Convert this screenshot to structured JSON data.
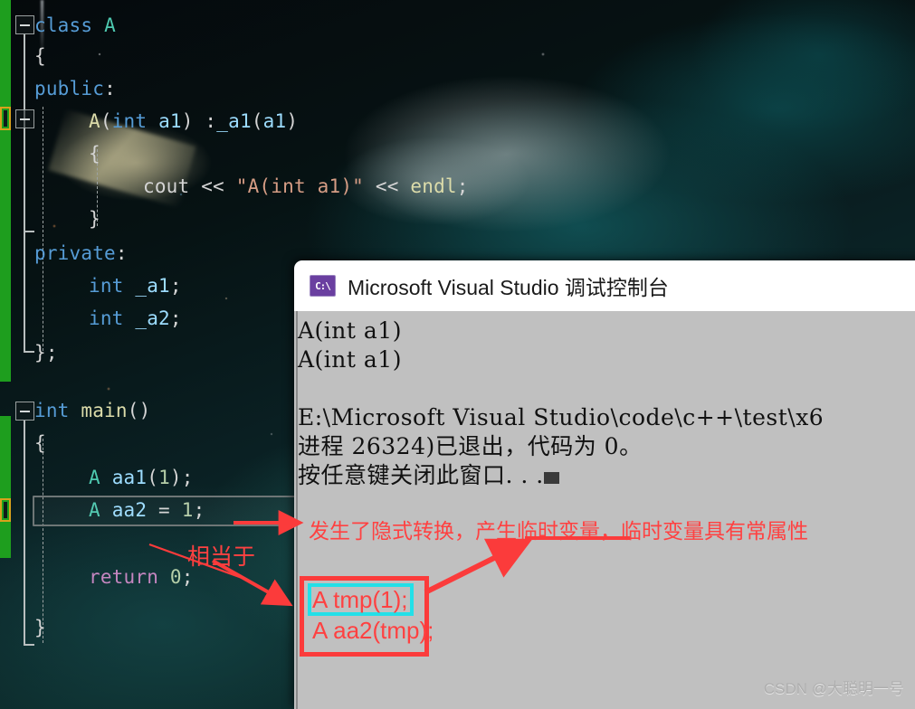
{
  "editor": {
    "language": "cpp",
    "lines": [
      {
        "indent": 0,
        "tokens": [
          {
            "t": "class ",
            "c": "kw"
          },
          {
            "t": "A",
            "c": "ty"
          }
        ]
      },
      {
        "indent": 1,
        "tokens": [
          {
            "t": "{",
            "c": "op"
          }
        ]
      },
      {
        "indent": 1,
        "tokens": [
          {
            "t": "public",
            "c": "kw"
          },
          {
            "t": ":",
            "c": "op"
          }
        ]
      },
      {
        "indent": 2,
        "tokens": [
          {
            "t": "A",
            "c": "pl"
          },
          {
            "t": "(",
            "c": "op"
          },
          {
            "t": "int",
            "c": "kw"
          },
          {
            "t": " ",
            "c": "op"
          },
          {
            "t": "a1",
            "c": "id"
          },
          {
            "t": ") :",
            "c": "op"
          },
          {
            "t": "_a1",
            "c": "id"
          },
          {
            "t": "(",
            "c": "op"
          },
          {
            "t": "a1",
            "c": "id"
          },
          {
            "t": ")",
            "c": "op"
          }
        ]
      },
      {
        "indent": 3,
        "tokens": [
          {
            "t": "{",
            "c": "op"
          }
        ]
      },
      {
        "indent": 4,
        "tokens": [
          {
            "t": "cout",
            "c": "op"
          },
          {
            "t": " << ",
            "c": "op"
          },
          {
            "t": "\"A(int a1)\"",
            "c": "st"
          },
          {
            "t": " << ",
            "c": "op"
          },
          {
            "t": "endl",
            "c": "pl"
          },
          {
            "t": ";",
            "c": "op"
          }
        ]
      },
      {
        "indent": 3,
        "tokens": [
          {
            "t": "}",
            "c": "op"
          }
        ]
      },
      {
        "indent": 1,
        "tokens": [
          {
            "t": "private",
            "c": "kw"
          },
          {
            "t": ":",
            "c": "op"
          }
        ]
      },
      {
        "indent": 2,
        "tokens": [
          {
            "t": "int",
            "c": "kw"
          },
          {
            "t": " ",
            "c": "op"
          },
          {
            "t": "_a1",
            "c": "id"
          },
          {
            "t": ";",
            "c": "op"
          }
        ]
      },
      {
        "indent": 2,
        "tokens": [
          {
            "t": "int",
            "c": "kw"
          },
          {
            "t": " ",
            "c": "op"
          },
          {
            "t": "_a2",
            "c": "id"
          },
          {
            "t": ";",
            "c": "op"
          }
        ]
      },
      {
        "indent": 1,
        "tokens": [
          {
            "t": "};",
            "c": "op"
          }
        ]
      },
      {
        "indent": 0,
        "tokens": []
      },
      {
        "indent": 0,
        "tokens": [
          {
            "t": "int",
            "c": "kw"
          },
          {
            "t": " ",
            "c": "op"
          },
          {
            "t": "main",
            "c": "pl"
          },
          {
            "t": "()",
            "c": "op"
          }
        ]
      },
      {
        "indent": 1,
        "tokens": [
          {
            "t": "{",
            "c": "op"
          }
        ]
      },
      {
        "indent": 2,
        "tokens": [
          {
            "t": "A",
            "c": "ty"
          },
          {
            "t": " ",
            "c": "op"
          },
          {
            "t": "aa1",
            "c": "id"
          },
          {
            "t": "(",
            "c": "op"
          },
          {
            "t": "1",
            "c": "num"
          },
          {
            "t": ");",
            "c": "op"
          }
        ]
      },
      {
        "indent": 2,
        "tokens": [
          {
            "t": "A",
            "c": "ty"
          },
          {
            "t": " ",
            "c": "op"
          },
          {
            "t": "aa2",
            "c": "id"
          },
          {
            "t": " = ",
            "c": "op"
          },
          {
            "t": "1",
            "c": "num"
          },
          {
            "t": ";",
            "c": "op"
          }
        ]
      },
      {
        "indent": 2,
        "tokens": []
      },
      {
        "indent": 2,
        "tokens": [
          {
            "t": "return",
            "c": "ctl"
          },
          {
            "t": " ",
            "c": "op"
          },
          {
            "t": "0",
            "c": "num"
          },
          {
            "t": ";",
            "c": "op"
          }
        ]
      },
      {
        "indent": 1,
        "tokens": [
          {
            "t": "}",
            "c": "op"
          }
        ]
      }
    ],
    "code_text": [
      "class A",
      "{",
      "public:",
      "    A(int a1) :_a1(a1)",
      "    {",
      "        cout << \"A(int a1)\" << endl;",
      "    }",
      "private:",
      "    int _a1;",
      "    int _a2;",
      "};",
      "",
      "int main()",
      "{",
      "    A aa1(1);",
      "    A aa2 = 1;",
      "",
      "    return 0;",
      "}"
    ],
    "current_line": "A aa2 = 1;"
  },
  "console": {
    "icon": "console-app-icon",
    "icon_glyph": "C:\\",
    "title": "Microsoft Visual Studio 调试控制台",
    "output": [
      "A(int a1)",
      "A(int a1)",
      "",
      "E:\\Microsoft Visual Studio\\code\\c++\\test\\x6",
      "进程 26324)已退出，代码为 0。",
      "按任意键关闭此窗口. . ."
    ]
  },
  "annotations": {
    "note_main": "发生了隐式转换，产生临时变量，临时变量具有常属性",
    "note_equivalent": "相当于",
    "code_box": {
      "line_highlighted": "A tmp(1);",
      "line_second": "A aa2(tmp);"
    },
    "colors": {
      "annotation_red": "#ff4141",
      "box_red": "#fb3b3b",
      "box_cyan": "#22e0e8",
      "gutter_green": "#1e9e1e",
      "bookmark_orange": "#d8a21c"
    }
  },
  "watermark": {
    "text": "CSDN @大聪明一号"
  }
}
